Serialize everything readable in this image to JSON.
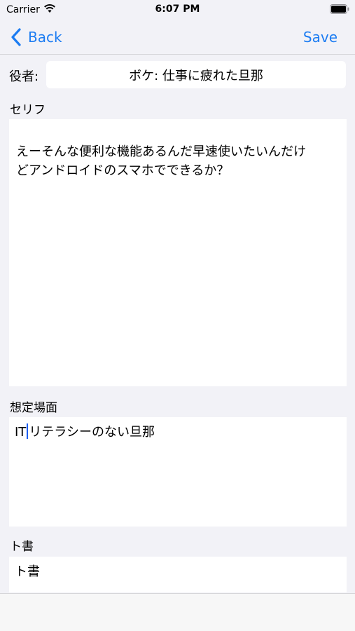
{
  "status_bar": {
    "carrier": "Carrier",
    "time": "6:07 PM"
  },
  "nav": {
    "back_label": "Back",
    "save_label": "Save"
  },
  "form": {
    "role_label": "役者:",
    "role_value": "ボケ: 仕事に疲れた旦那",
    "serif_label": "セリフ",
    "serif_line1": "えーそんな便利な機能あるんだ早速使いたいんだけ",
    "serif_line2": "どアンドロイドのスマホでできるか？",
    "scene_label": "想定場面",
    "scene_value_before_cursor": "IT",
    "scene_value_after_cursor": "リテラシーのない旦那",
    "direction_label": "ト書",
    "direction_value": "ト書"
  },
  "colors": {
    "accent": "#1c7cf2",
    "background": "#f2f2f7"
  }
}
